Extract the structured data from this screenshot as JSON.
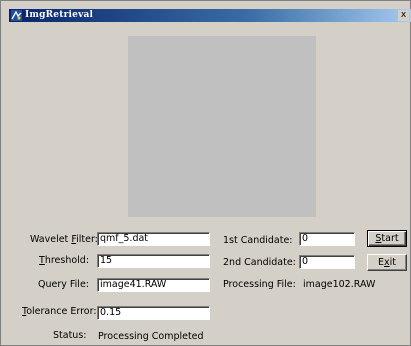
{
  "window": {
    "title": "ImgRetrieval",
    "close_glyph": "x"
  },
  "labels": {
    "wavelet_pre": "Wavelet ",
    "wavelet_u": "F",
    "wavelet_post": "ilter:",
    "threshold_u": "T",
    "threshold_post": "hreshold:",
    "query_file": "Query File:",
    "tolerance_u": "T",
    "tolerance_post": "olerance Error:",
    "status": "Status:",
    "candidate1": "1st Candidate:",
    "candidate2": "2nd Candidate:",
    "processing_file": "Processing File:"
  },
  "fields": {
    "wavelet_filter": "qmf_5.dat",
    "threshold": "15",
    "query_file": "image41.RAW",
    "tolerance_error": "0.15",
    "candidate1": "0",
    "candidate2": "0"
  },
  "status": {
    "value": "Processing Completed",
    "processing_file": "image102.RAW"
  },
  "buttons": {
    "start_u": "S",
    "start_post": "tart",
    "exit_pre": "E",
    "exit_u": "x",
    "exit_post": "it"
  },
  "colors": {
    "window_bg": "#d4d0c8",
    "title_start": "#0a246a",
    "title_end": "#a6caf0",
    "canvas": "#c0c0c0"
  },
  "icons": {
    "app": "app-icon",
    "close": "close-icon"
  }
}
